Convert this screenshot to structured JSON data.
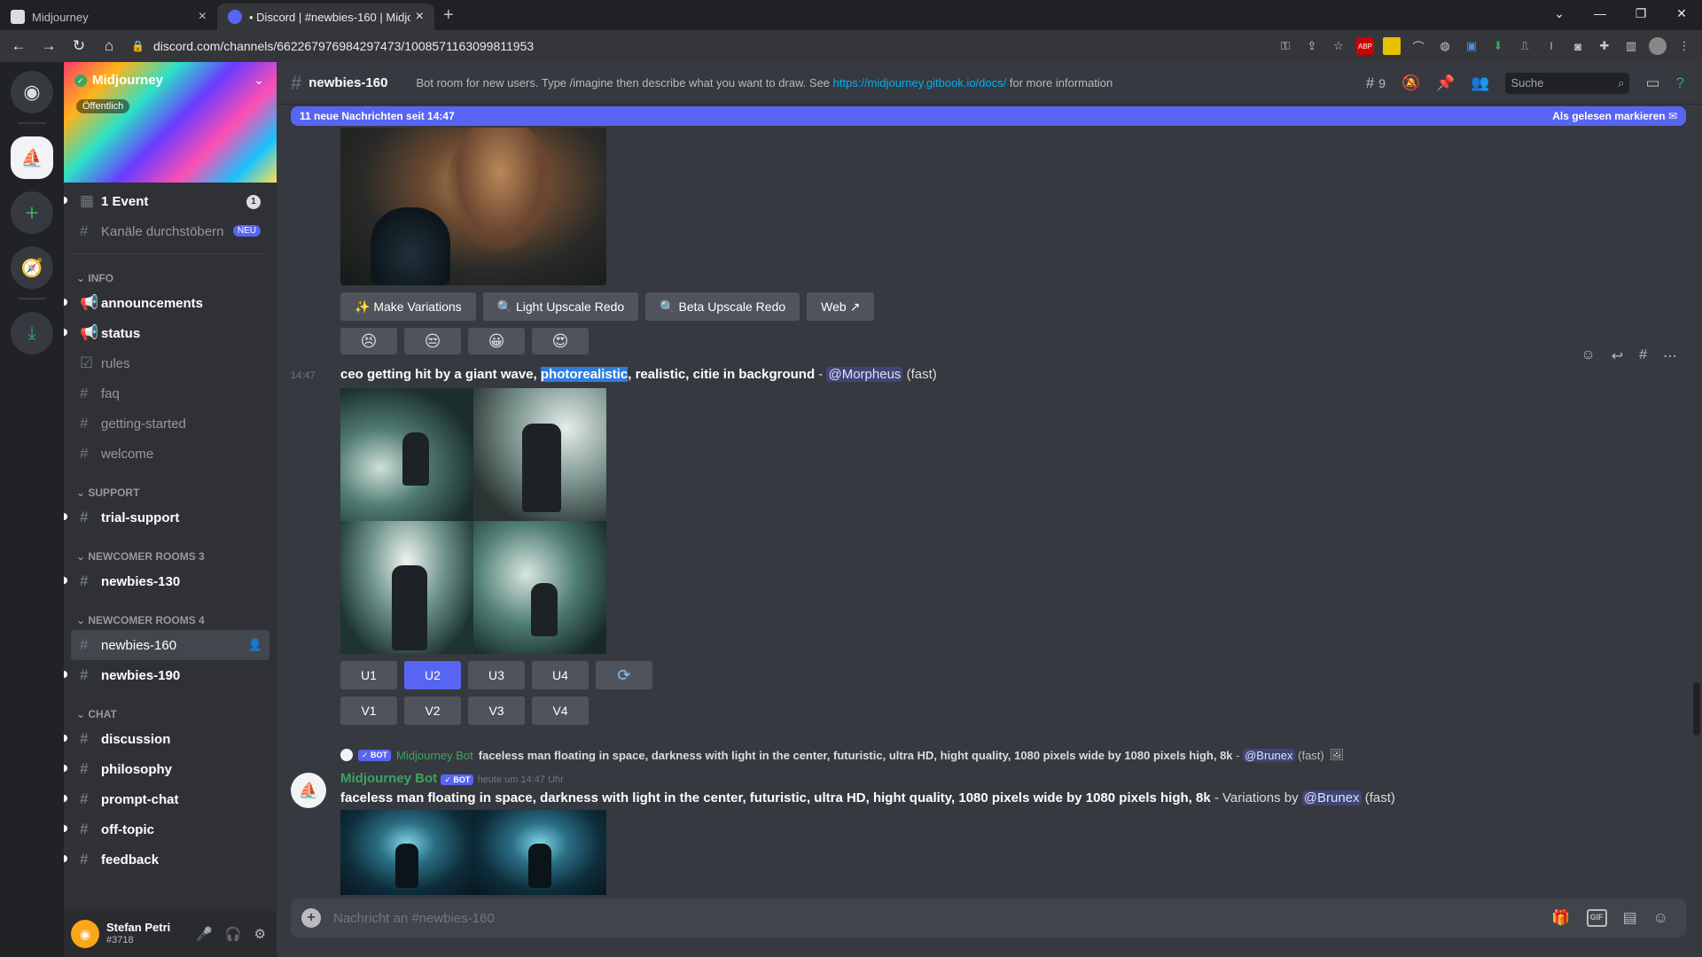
{
  "browser": {
    "tabs": [
      {
        "title": "Midjourney",
        "active": false
      },
      {
        "title": "• Discord | #newbies-160 | Midjo",
        "active": true
      }
    ],
    "url": "discord.com/channels/662267976984297473/1008571163099811953",
    "window_controls": [
      "⌄",
      "—",
      "❐",
      "✕"
    ]
  },
  "server": {
    "name": "Midjourney",
    "visibility": "Öffentlich",
    "event_label": "1 Event",
    "event_count": "1",
    "browse_label": "Kanäle durchstöbern",
    "browse_badge": "NEU"
  },
  "categories": {
    "info": "INFO",
    "support": "SUPPORT",
    "newcomer3": "NEWCOMER ROOMS 3",
    "newcomer4": "NEWCOMER ROOMS 4",
    "chat": "CHAT"
  },
  "channels": {
    "announcements": "announcements",
    "status": "status",
    "rules": "rules",
    "faq": "faq",
    "getting_started": "getting-started",
    "welcome": "welcome",
    "trial_support": "trial-support",
    "newbies130": "newbies-130",
    "newbies160": "newbies-160",
    "newbies190": "newbies-190",
    "discussion": "discussion",
    "philosophy": "philosophy",
    "prompt_chat": "prompt-chat",
    "off_topic": "off-topic",
    "feedback": "feedback"
  },
  "user": {
    "name": "Stefan Petri",
    "tag": "#3718"
  },
  "header": {
    "channel": "newbies-160",
    "topic_prefix": "Bot room for new users. Type /imagine then describe what you want to draw. See ",
    "topic_link": "https://midjourney.gitbook.io/docs/",
    "topic_suffix": " for more information",
    "threads_count": "9",
    "search_placeholder": "Suche"
  },
  "new_messages_bar": {
    "text": "11 neue Nachrichten seit 14:47",
    "action": "Als gelesen markieren"
  },
  "message1": {
    "buttons": [
      "Make Variations",
      "Light Upscale Redo",
      "Beta Upscale Redo",
      "Web"
    ],
    "reactions": [
      "😣",
      "😒",
      "😀",
      "😍"
    ]
  },
  "message2": {
    "time": "14:47",
    "prompt_a": "ceo getting hit by a giant wave, ",
    "prompt_hl": "photorealistic",
    "prompt_b": ", realistic, citie in background",
    "sep": " - ",
    "mention": "@Morpheus",
    "speed": "(fast)",
    "upscale": [
      "U1",
      "U2",
      "U3",
      "U4"
    ],
    "variation": [
      "V1",
      "V2",
      "V3",
      "V4"
    ],
    "refresh": "⟳"
  },
  "message3": {
    "reply_bot": "Midjourney Bot",
    "reply_text": "faceless man floating in space, darkness with light in the center, futuristic, ultra HD, hight quality, 1080 pixels wide by 1080 pixels high, 8k",
    "reply_mention": "@Brunex",
    "reply_speed": "(fast)",
    "author": "Midjourney Bot",
    "bot_badge": "✓ BOT",
    "timestamp": "heute um 14:47 Uhr",
    "prompt": "faceless man floating in space, darkness with light in the center, futuristic, ultra HD, hight quality, 1080 pixels wide by 1080 pixels high, 8k",
    "variations_by": " - Variations by ",
    "mention": "@Brunex",
    "speed": "(fast)"
  },
  "composer": {
    "placeholder": "Nachricht an #newbies-160"
  },
  "colors": {
    "blurple": "#5865f2",
    "green": "#3ba55d",
    "bg": "#36393f"
  }
}
